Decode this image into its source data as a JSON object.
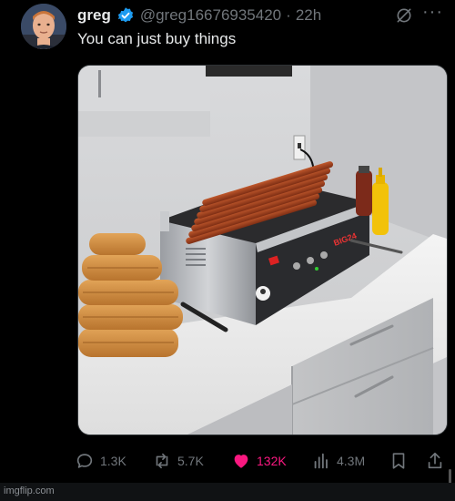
{
  "tweet": {
    "display_name": "greg",
    "handle": "@greg16676935420",
    "separator": "·",
    "time": "22h",
    "text": "You can just buy things",
    "more_label": "···"
  },
  "media": {
    "alt": "Hot dog roller grill on a kitchen counter with stacked buns and mustard bottle",
    "grill_brand": "BIG24"
  },
  "actions": {
    "replies": "1.3K",
    "retweets": "5.7K",
    "likes": "132K",
    "views": "4.3M"
  },
  "footer": {
    "watermark": "imgflip.com"
  },
  "colors": {
    "background": "#000000",
    "text": "#e7e9ea",
    "muted": "#71767b",
    "like": "#f91880",
    "verified": "#1d9bf0"
  }
}
